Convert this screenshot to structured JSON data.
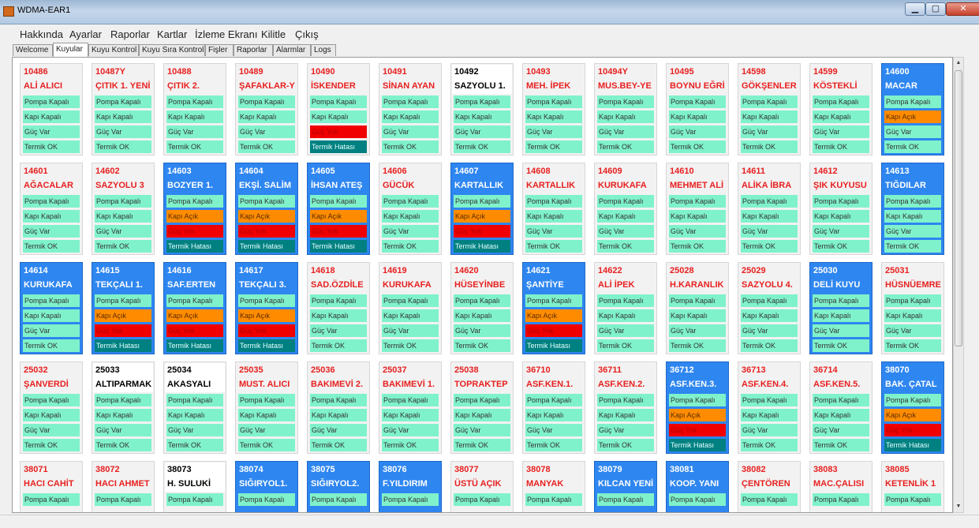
{
  "window": {
    "title": "WDMA-EAR1",
    "min": "▁",
    "max": "▢",
    "close": "✕"
  },
  "menu": [
    "Hakkında",
    "Ayarlar",
    "Raporlar",
    "Kartlar",
    "İzleme Ekranı",
    "Kilitle",
    "Çıkış"
  ],
  "tabs": [
    "Welcome",
    "Kuyular",
    "Kuyu Kontrol",
    "Kuyu Sıra Kontrol",
    "Fişler",
    "Raporlar",
    "Alarmlar",
    "Logs"
  ],
  "active_tab": "Kuyular",
  "scrollbar": {
    "up": "▲",
    "down": "▼"
  },
  "well_rows": [
    [
      {
        "id": "10486",
        "name": "ALİ ALICI",
        "style": "normal",
        "status": [
          "Pompa Kapalı",
          "Kapı Kapalı",
          "Güç Var",
          "Termik OK"
        ],
        "colors": [
          "ok",
          "ok",
          "ok",
          "ok"
        ]
      },
      {
        "id": "10487Y",
        "name": "ÇITIK 1. YENİ",
        "style": "normal",
        "status": [
          "Pompa Kapalı",
          "Kapı Kapalı",
          "Güç Var",
          "Termik OK"
        ],
        "colors": [
          "ok",
          "ok",
          "ok",
          "ok"
        ]
      },
      {
        "id": "10488",
        "name": "ÇITIK 2.",
        "style": "normal",
        "status": [
          "Pompa Kapalı",
          "Kapı Kapalı",
          "Güç Var",
          "Termik OK"
        ],
        "colors": [
          "ok",
          "ok",
          "ok",
          "ok"
        ]
      },
      {
        "id": "10489",
        "name": "ŞAFAKLAR-Y",
        "style": "normal",
        "status": [
          "Pompa Kapalı",
          "Kapı Kapalı",
          "Güç Var",
          "Termik OK"
        ],
        "colors": [
          "ok",
          "ok",
          "ok",
          "ok"
        ]
      },
      {
        "id": "10490",
        "name": "İSKENDER",
        "style": "normal",
        "status": [
          "Pompa Kapalı",
          "Kapı Kapalı",
          "Güç Yok",
          "Termik Hatası"
        ],
        "colors": [
          "ok",
          "ok",
          "red",
          "teal"
        ]
      },
      {
        "id": "10491",
        "name": "SİNAN AYAN",
        "style": "normal",
        "status": [
          "Pompa Kapalı",
          "Kapı Kapalı",
          "Güç Var",
          "Termik OK"
        ],
        "colors": [
          "ok",
          "ok",
          "ok",
          "ok"
        ]
      },
      {
        "id": "10492",
        "name": "SAZYOLU 1.",
        "style": "white",
        "status": [
          "Pompa Kapalı",
          "Kapı Kapalı",
          "Güç Var",
          "Termik OK"
        ],
        "colors": [
          "ok",
          "ok",
          "ok",
          "ok"
        ]
      },
      {
        "id": "10493",
        "name": "MEH. İPEK",
        "style": "normal",
        "status": [
          "Pompa Kapalı",
          "Kapı Kapalı",
          "Güç Var",
          "Termik OK"
        ],
        "colors": [
          "ok",
          "ok",
          "ok",
          "ok"
        ]
      },
      {
        "id": "10494Y",
        "name": "MUS.BEY-YE",
        "style": "normal",
        "status": [
          "Pompa Kapalı",
          "Kapı Kapalı",
          "Güç Var",
          "Termik OK"
        ],
        "colors": [
          "ok",
          "ok",
          "ok",
          "ok"
        ]
      },
      {
        "id": "10495",
        "name": "BOYNU EĞRİ",
        "style": "normal",
        "status": [
          "Pompa Kapalı",
          "Kapı Kapalı",
          "Güç Var",
          "Termik OK"
        ],
        "colors": [
          "ok",
          "ok",
          "ok",
          "ok"
        ]
      },
      {
        "id": "14598",
        "name": "GÖKŞENLER",
        "style": "normal",
        "status": [
          "Pompa Kapalı",
          "Kapı Kapalı",
          "Güç Var",
          "Termik OK"
        ],
        "colors": [
          "ok",
          "ok",
          "ok",
          "ok"
        ]
      },
      {
        "id": "14599",
        "name": "KÖSTEKLİ",
        "style": "normal",
        "status": [
          "Pompa Kapalı",
          "Kapı Kapalı",
          "Güç Var",
          "Termik OK"
        ],
        "colors": [
          "ok",
          "ok",
          "ok",
          "ok"
        ]
      },
      {
        "id": "14600",
        "name": "MACAR",
        "style": "blue",
        "status": [
          "Pompa Kapalı",
          "Kapı Açık",
          "Güç Var",
          "Termik OK"
        ],
        "colors": [
          "ok",
          "orange",
          "ok",
          "ok"
        ]
      }
    ],
    [
      {
        "id": "14601",
        "name": "AĞACALAR",
        "style": "normal",
        "status": [
          "Pompa Kapalı",
          "Kapı Kapalı",
          "Güç Var",
          "Termik OK"
        ],
        "colors": [
          "ok",
          "ok",
          "ok",
          "ok"
        ]
      },
      {
        "id": "14602",
        "name": "SAZYOLU 3",
        "style": "normal",
        "status": [
          "Pompa Kapalı",
          "Kapı Kapalı",
          "Güç Var",
          "Termik OK"
        ],
        "colors": [
          "ok",
          "ok",
          "ok",
          "ok"
        ]
      },
      {
        "id": "14603",
        "name": "BOZYER 1.",
        "style": "blue",
        "status": [
          "Pompa Kapalı",
          "Kapı Açık",
          "Güç Yok",
          "Termik Hatası"
        ],
        "colors": [
          "ok",
          "orange",
          "red",
          "teal"
        ]
      },
      {
        "id": "14604",
        "name": "EKŞİ. SALİM",
        "style": "blue",
        "status": [
          "Pompa Kapalı",
          "Kapı Açık",
          "Güç Yok",
          "Termik Hatası"
        ],
        "colors": [
          "ok",
          "orange",
          "red",
          "teal"
        ]
      },
      {
        "id": "14605",
        "name": "İHSAN ATEŞ",
        "style": "blue",
        "status": [
          "Pompa Kapalı",
          "Kapı Açık",
          "Güç Yok",
          "Termik Hatası"
        ],
        "colors": [
          "ok",
          "orange",
          "red",
          "teal"
        ]
      },
      {
        "id": "14606",
        "name": "GÜCÜK",
        "style": "normal",
        "status": [
          "Pompa Kapalı",
          "Kapı Kapalı",
          "Güç Var",
          "Termik OK"
        ],
        "colors": [
          "ok",
          "ok",
          "ok",
          "ok"
        ]
      },
      {
        "id": "14607",
        "name": "KARTALLIK",
        "style": "blue",
        "status": [
          "Pompa Kapalı",
          "Kapı Açık",
          "Güç Yok",
          "Termik Hatası"
        ],
        "colors": [
          "ok",
          "orange",
          "red",
          "teal"
        ]
      },
      {
        "id": "14608",
        "name": "KARTALLIK",
        "style": "normal",
        "status": [
          "Pompa Kapalı",
          "Kapı Kapalı",
          "Güç Var",
          "Termik OK"
        ],
        "colors": [
          "ok",
          "ok",
          "ok",
          "ok"
        ]
      },
      {
        "id": "14609",
        "name": "KURUKAFA",
        "style": "normal",
        "status": [
          "Pompa Kapalı",
          "Kapı Kapalı",
          "Güç Var",
          "Termik OK"
        ],
        "colors": [
          "ok",
          "ok",
          "ok",
          "ok"
        ]
      },
      {
        "id": "14610",
        "name": "MEHMET ALİ",
        "style": "normal",
        "status": [
          "Pompa Kapalı",
          "Kapı Kapalı",
          "Güç Var",
          "Termik OK"
        ],
        "colors": [
          "ok",
          "ok",
          "ok",
          "ok"
        ]
      },
      {
        "id": "14611",
        "name": "ALİKA İBRA",
        "style": "normal",
        "status": [
          "Pompa Kapalı",
          "Kapı Kapalı",
          "Güç Var",
          "Termik OK"
        ],
        "colors": [
          "ok",
          "ok",
          "ok",
          "ok"
        ]
      },
      {
        "id": "14612",
        "name": "ŞIK KUYUSU",
        "style": "normal",
        "status": [
          "Pompa Kapalı",
          "Kapı Kapalı",
          "Güç Var",
          "Termik OK"
        ],
        "colors": [
          "ok",
          "ok",
          "ok",
          "ok"
        ]
      },
      {
        "id": "14613",
        "name": "TIĞDILAR",
        "style": "blue",
        "status": [
          "Pompa Kapalı",
          "Kapı Kapalı",
          "Güç Var",
          "Termik OK"
        ],
        "colors": [
          "ok",
          "ok",
          "ok",
          "ok"
        ]
      }
    ],
    [
      {
        "id": "14614",
        "name": "KURUKAFA",
        "style": "blue",
        "status": [
          "Pompa Kapalı",
          "Kapı Kapalı",
          "Güç Var",
          "Termik OK"
        ],
        "colors": [
          "ok",
          "ok",
          "ok",
          "ok"
        ]
      },
      {
        "id": "14615",
        "name": "TEKÇALI 1.",
        "style": "blue",
        "status": [
          "Pompa Kapalı",
          "Kapı Açık",
          "Güç Yok",
          "Termik Hatası"
        ],
        "colors": [
          "ok",
          "orange",
          "red",
          "teal"
        ]
      },
      {
        "id": "14616",
        "name": "SAF.ERTEN",
        "style": "blue",
        "status": [
          "Pompa Kapalı",
          "Kapı Açık",
          "Güç Yok",
          "Termik Hatası"
        ],
        "colors": [
          "ok",
          "orange",
          "red",
          "teal"
        ]
      },
      {
        "id": "14617",
        "name": "TEKÇALI 3.",
        "style": "blue",
        "status": [
          "Pompa Kapalı",
          "Kapı Açık",
          "Güç Yok",
          "Termik Hatası"
        ],
        "colors": [
          "ok",
          "orange",
          "red",
          "teal"
        ]
      },
      {
        "id": "14618",
        "name": "SAD.ÖZDİLE",
        "style": "normal",
        "status": [
          "Pompa Kapalı",
          "Kapı Kapalı",
          "Güç Var",
          "Termik OK"
        ],
        "colors": [
          "ok",
          "ok",
          "ok",
          "ok"
        ]
      },
      {
        "id": "14619",
        "name": "KURUKAFA",
        "style": "normal",
        "status": [
          "Pompa Kapalı",
          "Kapı Kapalı",
          "Güç Var",
          "Termik OK"
        ],
        "colors": [
          "ok",
          "ok",
          "ok",
          "ok"
        ]
      },
      {
        "id": "14620",
        "name": "HÜSEYİNBE",
        "style": "normal",
        "status": [
          "Pompa Kapalı",
          "Kapı Kapalı",
          "Güç Var",
          "Termik OK"
        ],
        "colors": [
          "ok",
          "ok",
          "ok",
          "ok"
        ]
      },
      {
        "id": "14621",
        "name": "ŞANTİYE",
        "style": "blue",
        "status": [
          "Pompa Kapalı",
          "Kapı Açık",
          "Güç Yok",
          "Termik Hatası"
        ],
        "colors": [
          "ok",
          "orange",
          "red",
          "teal"
        ]
      },
      {
        "id": "14622",
        "name": "ALİ İPEK",
        "style": "normal",
        "status": [
          "Pompa Kapalı",
          "Kapı Kapalı",
          "Güç Var",
          "Termik OK"
        ],
        "colors": [
          "ok",
          "ok",
          "ok",
          "ok"
        ]
      },
      {
        "id": "25028",
        "name": "H.KARANLIK",
        "style": "normal",
        "status": [
          "Pompa Kapalı",
          "Kapı Kapalı",
          "Güç Var",
          "Termik OK"
        ],
        "colors": [
          "ok",
          "ok",
          "ok",
          "ok"
        ]
      },
      {
        "id": "25029",
        "name": "SAZYOLU 4.",
        "style": "normal",
        "status": [
          "Pompa Kapalı",
          "Kapı Kapalı",
          "Güç Var",
          "Termik OK"
        ],
        "colors": [
          "ok",
          "ok",
          "ok",
          "ok"
        ]
      },
      {
        "id": "25030",
        "name": "DELİ KUYU",
        "style": "blue",
        "status": [
          "Pompa Kapalı",
          "Kapı Kapalı",
          "Güç Var",
          "Termik OK"
        ],
        "colors": [
          "ok",
          "ok",
          "ok",
          "ok"
        ]
      },
      {
        "id": "25031",
        "name": "HÜSNÜEMRE",
        "style": "normal",
        "status": [
          "Pompa Kapalı",
          "Kapı Kapalı",
          "Güç Var",
          "Termik OK"
        ],
        "colors": [
          "ok",
          "ok",
          "ok",
          "ok"
        ]
      }
    ],
    [
      {
        "id": "25032",
        "name": "ŞANVERDİ",
        "style": "normal",
        "status": [
          "Pompa Kapalı",
          "Kapı Kapalı",
          "Güç Var",
          "Termik OK"
        ],
        "colors": [
          "ok",
          "ok",
          "ok",
          "ok"
        ]
      },
      {
        "id": "25033",
        "name": "ALTIPARMAK",
        "style": "white",
        "status": [
          "Pompa Kapalı",
          "Kapı Kapalı",
          "Güç Var",
          "Termik OK"
        ],
        "colors": [
          "ok",
          "ok",
          "ok",
          "ok"
        ]
      },
      {
        "id": "25034",
        "name": "AKASYALI",
        "style": "white",
        "status": [
          "Pompa Kapalı",
          "Kapı Kapalı",
          "Güç Var",
          "Termik OK"
        ],
        "colors": [
          "ok",
          "ok",
          "ok",
          "ok"
        ]
      },
      {
        "id": "25035",
        "name": "MUST. ALICI",
        "style": "normal",
        "status": [
          "Pompa Kapalı",
          "Kapı Kapalı",
          "Güç Var",
          "Termik OK"
        ],
        "colors": [
          "ok",
          "ok",
          "ok",
          "ok"
        ]
      },
      {
        "id": "25036",
        "name": "BAKIMEVİ 2.",
        "style": "normal",
        "status": [
          "Pompa Kapalı",
          "Kapı Kapalı",
          "Güç Var",
          "Termik OK"
        ],
        "colors": [
          "ok",
          "ok",
          "ok",
          "ok"
        ]
      },
      {
        "id": "25037",
        "name": "BAKIMEVİ 1.",
        "style": "normal",
        "status": [
          "Pompa Kapalı",
          "Kapı Kapalı",
          "Güç Var",
          "Termik OK"
        ],
        "colors": [
          "ok",
          "ok",
          "ok",
          "ok"
        ]
      },
      {
        "id": "25038",
        "name": "TOPRAKTEP",
        "style": "normal",
        "status": [
          "Pompa Kapalı",
          "Kapı Kapalı",
          "Güç Var",
          "Termik OK"
        ],
        "colors": [
          "ok",
          "ok",
          "ok",
          "ok"
        ]
      },
      {
        "id": "36710",
        "name": "ASF.KEN.1.",
        "style": "normal",
        "status": [
          "Pompa Kapalı",
          "Kapı Kapalı",
          "Güç Var",
          "Termik OK"
        ],
        "colors": [
          "ok",
          "ok",
          "ok",
          "ok"
        ]
      },
      {
        "id": "36711",
        "name": "ASF.KEN.2.",
        "style": "normal",
        "status": [
          "Pompa Kapalı",
          "Kapı Kapalı",
          "Güç Var",
          "Termik OK"
        ],
        "colors": [
          "ok",
          "ok",
          "ok",
          "ok"
        ]
      },
      {
        "id": "36712",
        "name": "ASF.KEN.3.",
        "style": "blue",
        "status": [
          "Pompa Kapalı",
          "Kapı Açık",
          "Güç Yok",
          "Termik Hatası"
        ],
        "colors": [
          "ok",
          "orange",
          "red",
          "teal"
        ]
      },
      {
        "id": "36713",
        "name": "ASF.KEN.4.",
        "style": "normal",
        "status": [
          "Pompa Kapalı",
          "Kapı Kapalı",
          "Güç Var",
          "Termik OK"
        ],
        "colors": [
          "ok",
          "ok",
          "ok",
          "ok"
        ]
      },
      {
        "id": "36714",
        "name": "ASF.KEN.5.",
        "style": "normal",
        "status": [
          "Pompa Kapalı",
          "Kapı Kapalı",
          "Güç Var",
          "Termik OK"
        ],
        "colors": [
          "ok",
          "ok",
          "ok",
          "ok"
        ]
      },
      {
        "id": "38070",
        "name": "BAK. ÇATAL",
        "style": "blue",
        "status": [
          "Pompa Kapalı",
          "Kapı Açık",
          "Güç Yok",
          "Termik Hatası"
        ],
        "colors": [
          "ok",
          "orange",
          "red",
          "teal"
        ]
      }
    ],
    [
      {
        "id": "38071",
        "name": "HACI CAHİT",
        "style": "normal",
        "status": [
          "Pompa Kapalı"
        ],
        "colors": [
          "ok"
        ]
      },
      {
        "id": "38072",
        "name": "HACI AHMET",
        "style": "normal",
        "status": [
          "Pompa Kapalı"
        ],
        "colors": [
          "ok"
        ]
      },
      {
        "id": "38073",
        "name": "H. SULUKİ",
        "style": "white",
        "status": [
          "Pompa Kapalı"
        ],
        "colors": [
          "ok"
        ]
      },
      {
        "id": "38074",
        "name": "SIĞIRYOL1.",
        "style": "blue",
        "status": [
          "Pompa Kapalı"
        ],
        "colors": [
          "ok"
        ]
      },
      {
        "id": "38075",
        "name": "SIĞIRYOL2.",
        "style": "blue",
        "status": [
          "Pompa Kapalı"
        ],
        "colors": [
          "ok"
        ]
      },
      {
        "id": "38076",
        "name": "F.YILDIRIM",
        "style": "blue",
        "status": [
          "Pompa Kapalı"
        ],
        "colors": [
          "ok"
        ]
      },
      {
        "id": "38077",
        "name": "ÜSTÜ AÇIK",
        "style": "normal",
        "status": [
          "Pompa Kapalı"
        ],
        "colors": [
          "ok"
        ]
      },
      {
        "id": "38078",
        "name": "MANYAK",
        "style": "normal",
        "status": [
          "Pompa Kapalı"
        ],
        "colors": [
          "ok"
        ]
      },
      {
        "id": "38079",
        "name": "KILCAN YENİ",
        "style": "blue",
        "status": [
          "Pompa Kapalı"
        ],
        "colors": [
          "ok"
        ]
      },
      {
        "id": "38081",
        "name": "KOOP. YANI",
        "style": "blue",
        "status": [
          "Pompa Kapalı"
        ],
        "colors": [
          "ok"
        ]
      },
      {
        "id": "38082",
        "name": "ÇENTÖREN",
        "style": "normal",
        "status": [
          "Pompa Kapalı"
        ],
        "colors": [
          "ok"
        ]
      },
      {
        "id": "38083",
        "name": "MAC.ÇALISI",
        "style": "normal",
        "status": [
          "Pompa Kapalı"
        ],
        "colors": [
          "ok"
        ]
      },
      {
        "id": "38085",
        "name": "KETENLİK 1",
        "style": "normal",
        "status": [
          "Pompa Kapalı"
        ],
        "colors": [
          "ok"
        ]
      }
    ]
  ]
}
